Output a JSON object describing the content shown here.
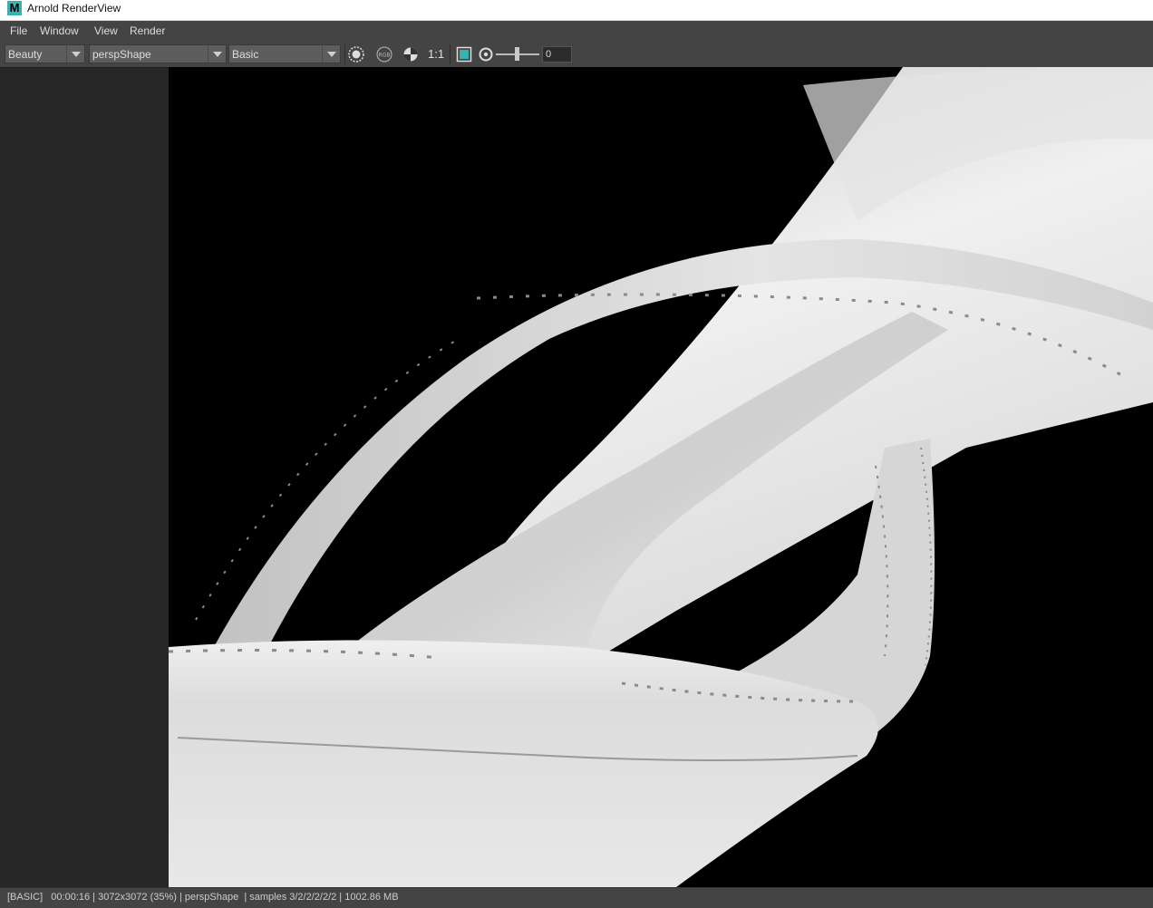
{
  "window": {
    "title": "Arnold RenderView",
    "app_icon_letter": "M"
  },
  "menu": [
    "File",
    "Window",
    "View",
    "Render"
  ],
  "toolbar": {
    "aov": "Beauty",
    "camera": "perspShape",
    "display_mode": "Basic",
    "zoom_label": "1:1",
    "exposure_value": "0",
    "icons": [
      "render-region-icon",
      "rgb-channel-icon",
      "display-toggle-icon",
      "crop-region-icon",
      "aperture-icon"
    ]
  },
  "status": {
    "text": "[BASIC]   00:00:16 | 3072x3072 (35%) | perspShape  | samples 3/2/2/2/2/2 | 1002.86 MB"
  },
  "colors": {
    "background": "#444444",
    "panel": "#272727",
    "viewport_bg": "#000000",
    "accent": "#36b3b0"
  }
}
